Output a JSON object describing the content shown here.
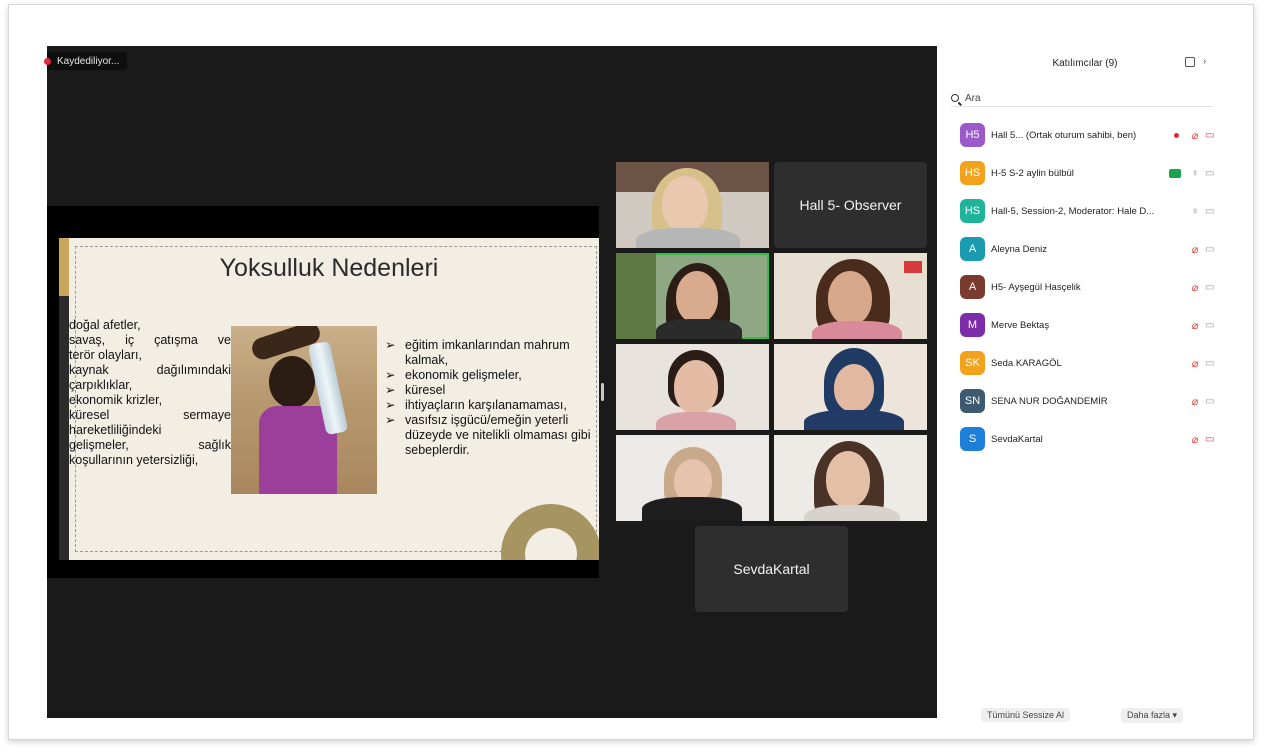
{
  "recording_label": "Kaydediliyor...",
  "slide": {
    "title": "Yoksulluk Nedenleri",
    "left_lines": [
      "doğal afetler,",
      "savaş, iç çatışma ve",
      "terör olayları,",
      "kaynak dağılımındaki",
      "çarpıklıklar,",
      "ekonomik krizler,",
      "küresel sermaye",
      "hareketliliğindeki",
      "gelişmeler, sağlık",
      "koşullarının yetersizliği,"
    ],
    "bullets": [
      "eğitim imkanlarından mahrum kalmak,",
      "ekonomik gelişmeler,",
      "küresel",
      "ihtiyaçların karşılanamaması,",
      "vasıfsız işgücü/emeğin yeterli düzeyde ve nitelikli olmaması gibi sebeplerdir."
    ],
    "bullet_marker": "➢"
  },
  "tiles": {
    "observer_name": "Hall 5- Observer",
    "sevda_name": "SevdaKartal"
  },
  "panel": {
    "title": "Katılımcılar (9)",
    "search_placeholder": "Ara",
    "close_glyph": "›",
    "participants": [
      {
        "initials": "H5",
        "name": "Hall 5...  (Ortak oturum sahibi, ben)",
        "color": "#9b59c9",
        "status": "muted"
      },
      {
        "initials": "HS",
        "name": "H-5 S-2 aylin bülbül",
        "color": "#f2a21b",
        "status": "mic"
      },
      {
        "initials": "HS",
        "name": "Hall-5, Session-2, Moderator: Hale D...",
        "color": "#1fb39b",
        "status": "mic"
      },
      {
        "initials": "A",
        "name": "Aleyna Deniz",
        "color": "#1a9bb0",
        "status": "muted"
      },
      {
        "initials": "A",
        "name": "H5- Ayşegül Hasçelik",
        "color": "#7a3b2e",
        "status": "muted"
      },
      {
        "initials": "M",
        "name": "Merve Bektaş",
        "color": "#7b2ca8",
        "status": "muted"
      },
      {
        "initials": "SK",
        "name": "Seda KARAGÖL",
        "color": "#f2a21b",
        "status": "muted"
      },
      {
        "initials": "SN",
        "name": "SENA NUR DOĞANDEMİR",
        "color": "#3d5a70",
        "status": "muted"
      },
      {
        "initials": "S",
        "name": "SevdaKartal",
        "color": "#1e7fd8",
        "status": "muted"
      }
    ],
    "mute_all_label": "Tümünü Sessize Al",
    "more_label": "Daha fazla ▾"
  }
}
